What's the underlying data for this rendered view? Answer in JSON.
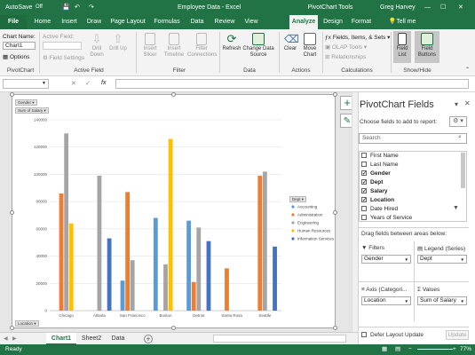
{
  "window": {
    "autosave": "AutoSave",
    "autosave_state": "Off",
    "title": "Employee Data  -  Excel",
    "context_title": "PivotChart Tools",
    "user": "Greg Harvey"
  },
  "tabs": [
    "File",
    "Home",
    "Insert",
    "Draw",
    "Page Layout",
    "Formulas",
    "Data",
    "Review",
    "View",
    "Analyze",
    "Design",
    "Format"
  ],
  "tell_me": "Tell me",
  "ribbon": {
    "chart_name_label": "Chart Name:",
    "chart_name_value": "Chart1",
    "options_label": "Options",
    "active_field_label": "Active Field:",
    "field_settings_label": "Field Settings",
    "drill_down": "Drill Down",
    "drill_up": "Drill Up",
    "insert_slicer": "Insert Slicer",
    "insert_timeline": "Insert Timeline",
    "filter_connections": "Filter Connections",
    "refresh": "Refresh",
    "change_data_source": "Change Data Source",
    "clear": "Clear",
    "move_chart": "Move Chart",
    "fields_items_sets": "Fields, Items, & Sets",
    "olap_tools": "OLAP Tools",
    "relationships": "Relationships",
    "field_list": "Field List",
    "field_buttons": "Field Buttons",
    "group_pivotchart": "PivotChart",
    "group_active_field": "Active Field",
    "group_filter": "Filter",
    "group_data": "Data",
    "group_actions": "Actions",
    "group_calculations": "Calculations",
    "group_show_hide": "Show/Hide"
  },
  "formula_bar": {
    "name_box": "",
    "fx": "fx"
  },
  "chart": {
    "filter_button": "Gender",
    "values_button": "Sum of Salary",
    "axis_button": "Location",
    "legend_title": "Dept"
  },
  "chart_data": {
    "type": "bar",
    "categories": [
      "Chicago",
      "Atlanta",
      "San Francisco",
      "Boston",
      "Detroit",
      "Santa Rosa",
      "Seattle"
    ],
    "yticks": [
      "0",
      "20000",
      "40000",
      "60000",
      "80000",
      "100000",
      "120000",
      "140000"
    ],
    "ylim": [
      0,
      140000
    ],
    "legend_placement": "right",
    "series": [
      {
        "name": "Accounting",
        "color": "#5b9bd5",
        "values": [
          0,
          0,
          22000,
          68000,
          66000,
          0,
          0
        ]
      },
      {
        "name": "Administration",
        "color": "#ed7d31",
        "values": [
          86000,
          0,
          87000,
          0,
          21000,
          31000,
          99000
        ]
      },
      {
        "name": "Engineering",
        "color": "#a5a5a5",
        "values": [
          130000,
          99000,
          37000,
          34000,
          61000,
          0,
          102000
        ]
      },
      {
        "name": "Human Resources",
        "color": "#ffc000",
        "values": [
          64000,
          0,
          0,
          126000,
          0,
          0,
          0
        ]
      },
      {
        "name": "Information Services",
        "color": "#4472c4",
        "values": [
          0,
          53000,
          0,
          0,
          51000,
          0,
          47000
        ]
      }
    ]
  },
  "sheet_tabs": [
    "Chart1",
    "Sheet2",
    "Data"
  ],
  "status": {
    "ready": "Ready",
    "zoom": "77%"
  },
  "panel": {
    "title": "PivotChart Fields",
    "subtitle": "Choose fields to add to report:",
    "search_placeholder": "Search",
    "fields": [
      {
        "label": "First Name",
        "checked": false
      },
      {
        "label": "Last Name",
        "checked": false
      },
      {
        "label": "Gender",
        "checked": true
      },
      {
        "label": "Dept",
        "checked": true
      },
      {
        "label": "Salary",
        "checked": true
      },
      {
        "label": "Location",
        "checked": true
      },
      {
        "label": "Date Hired",
        "checked": false
      },
      {
        "label": "Years of Service",
        "checked": false
      }
    ],
    "drag_label": "Drag fields between areas below:",
    "filters_label": "Filters",
    "legend_label": "Legend (Series)",
    "axis_label": "Axis (Categori...",
    "values_label": "Values",
    "filters_value": "Gender",
    "legend_value": "Dept",
    "axis_value": "Location",
    "values_value": "Sum of Salary",
    "defer_label": "Defer Layout Update",
    "update_label": "Update"
  }
}
